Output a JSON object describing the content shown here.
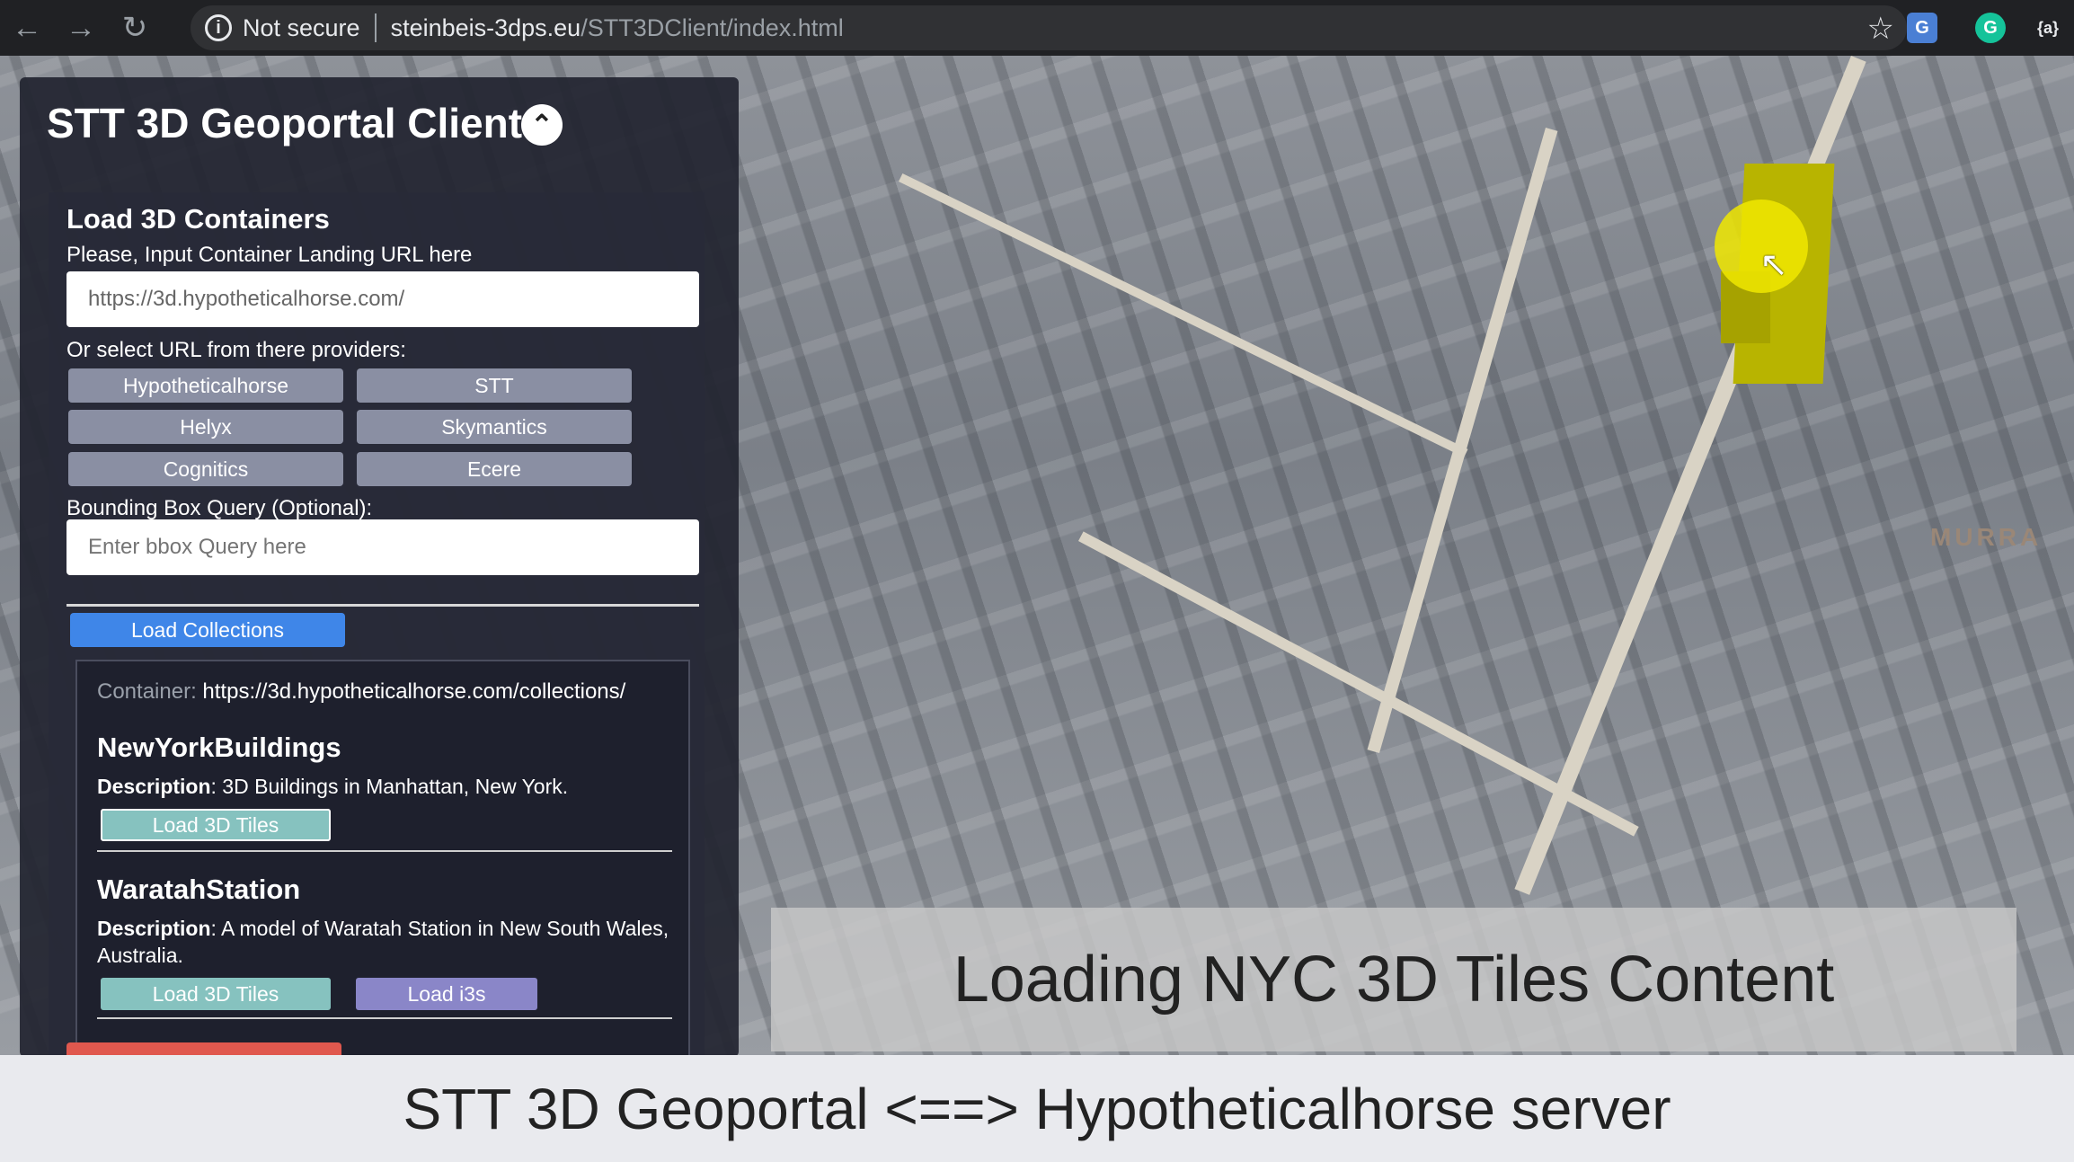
{
  "browser": {
    "security_label": "Not secure",
    "url_host": "steinbeis-3dps.eu",
    "url_path": "/STT3DClient/index.html",
    "icons": [
      "back-icon",
      "forward-icon",
      "reload-icon",
      "info-icon",
      "star-icon"
    ],
    "extensions": [
      "translate-extension-icon",
      "grammarly-extension-icon",
      "json-extension-icon"
    ],
    "ext_labels": {
      "translate": "G",
      "grammarly": "G",
      "json": "{a}"
    }
  },
  "panel": {
    "title": "STT 3D Geoportal Client",
    "collapse_icon": "chevron-up-icon",
    "section_title": "Load 3D Containers",
    "url_label": "Please, Input Container Landing URL here",
    "url_value": "https://3d.hypotheticalhorse.com/",
    "providers_label": "Or select URL from there providers:",
    "providers": [
      "Hypotheticalhorse",
      "STT",
      "Helyx",
      "Skymantics",
      "Cognitics",
      "Ecere"
    ],
    "bbox_label": "Bounding Box Query (Optional):",
    "bbox_placeholder": "Enter bbox Query here",
    "load_collections": "Load Collections",
    "container_key": "Container:",
    "container_value": "https://3d.hypotheticalhorse.com/collections/",
    "description_key": "Description",
    "collections": [
      {
        "name": "NewYorkBuildings",
        "description": ": 3D Buildings in Manhattan, New York.",
        "buttons": [
          "Load 3D Tiles"
        ]
      },
      {
        "name": "WaratahStation",
        "description": ": A model of Waratah Station in New South Wales, Australia.",
        "buttons": [
          "Load 3D Tiles",
          "Load i3s"
        ]
      }
    ]
  },
  "map": {
    "label_murray": "MURRA",
    "overlay_caption": "Loading NYC 3D Tiles Content",
    "fullscreen_icon": "fullscreen-icon",
    "highlight_color": "#b8b400"
  },
  "subtitle": "STT 3D Geoportal <==> Hypotheticalhorse server"
}
